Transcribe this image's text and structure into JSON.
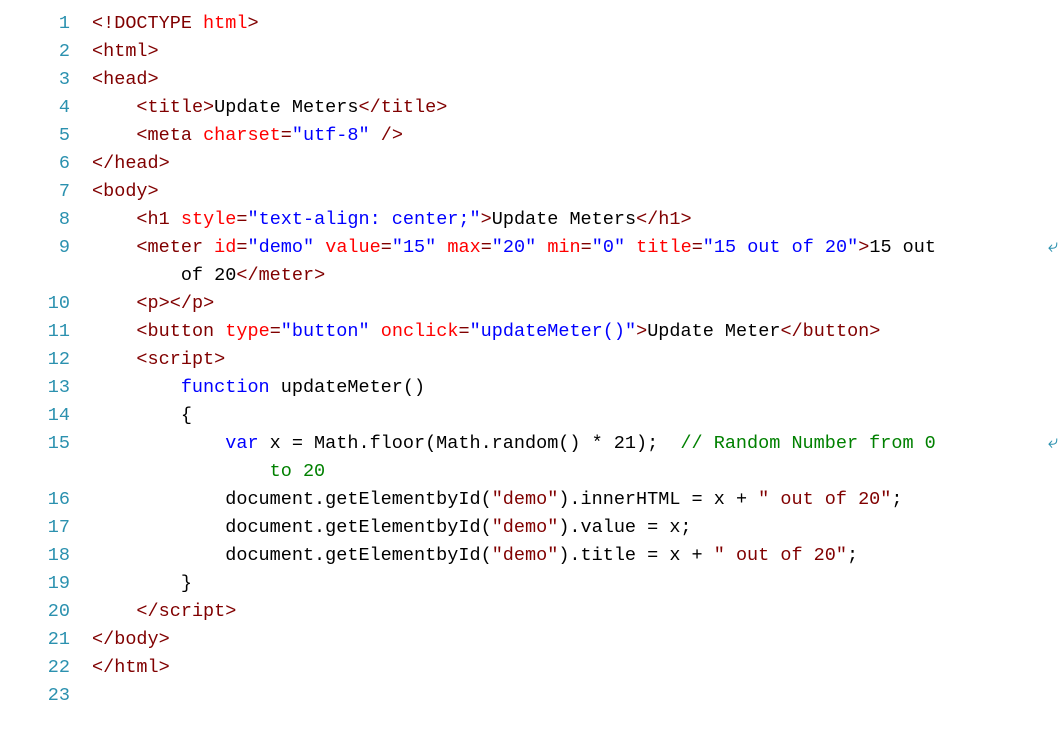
{
  "lines": [
    {
      "n": "1",
      "indent": 0,
      "wrap": false,
      "tokens": [
        {
          "c": "t-tag",
          "t": "<!"
        },
        {
          "c": "t-tagname",
          "t": "DOCTYPE"
        },
        {
          "c": "t-txt",
          "t": " "
        },
        {
          "c": "t-attr",
          "t": "html"
        },
        {
          "c": "t-tag",
          "t": ">"
        }
      ]
    },
    {
      "n": "2",
      "indent": 0,
      "wrap": false,
      "tokens": [
        {
          "c": "t-tag",
          "t": "<"
        },
        {
          "c": "t-tagname",
          "t": "html"
        },
        {
          "c": "t-tag",
          "t": ">"
        }
      ]
    },
    {
      "n": "3",
      "indent": 0,
      "wrap": false,
      "tokens": [
        {
          "c": "t-tag",
          "t": "<"
        },
        {
          "c": "t-tagname",
          "t": "head"
        },
        {
          "c": "t-tag",
          "t": ">"
        }
      ]
    },
    {
      "n": "4",
      "indent": 1,
      "wrap": false,
      "tokens": [
        {
          "c": "t-tag",
          "t": "<"
        },
        {
          "c": "t-tagname",
          "t": "title"
        },
        {
          "c": "t-tag",
          "t": ">"
        },
        {
          "c": "t-txt",
          "t": "Update Meters"
        },
        {
          "c": "t-tag",
          "t": "</"
        },
        {
          "c": "t-tagname",
          "t": "title"
        },
        {
          "c": "t-tag",
          "t": ">"
        }
      ]
    },
    {
      "n": "5",
      "indent": 1,
      "wrap": false,
      "tokens": [
        {
          "c": "t-tag",
          "t": "<"
        },
        {
          "c": "t-tagname",
          "t": "meta"
        },
        {
          "c": "t-txt",
          "t": " "
        },
        {
          "c": "t-attr",
          "t": "charset"
        },
        {
          "c": "t-tag",
          "t": "="
        },
        {
          "c": "t-str",
          "t": "\"utf-8\""
        },
        {
          "c": "t-txt",
          "t": " "
        },
        {
          "c": "t-tag",
          "t": "/>"
        }
      ]
    },
    {
      "n": "6",
      "indent": 0,
      "wrap": false,
      "tokens": [
        {
          "c": "t-tag",
          "t": "</"
        },
        {
          "c": "t-tagname",
          "t": "head"
        },
        {
          "c": "t-tag",
          "t": ">"
        }
      ]
    },
    {
      "n": "7",
      "indent": 0,
      "wrap": false,
      "tokens": [
        {
          "c": "t-tag",
          "t": "<"
        },
        {
          "c": "t-tagname",
          "t": "body"
        },
        {
          "c": "t-tag",
          "t": ">"
        }
      ]
    },
    {
      "n": "8",
      "indent": 1,
      "wrap": false,
      "tokens": [
        {
          "c": "t-tag",
          "t": "<"
        },
        {
          "c": "t-tagname",
          "t": "h1"
        },
        {
          "c": "t-txt",
          "t": " "
        },
        {
          "c": "t-attr",
          "t": "style"
        },
        {
          "c": "t-tag",
          "t": "="
        },
        {
          "c": "t-str",
          "t": "\"text-align: center;\""
        },
        {
          "c": "t-tag",
          "t": ">"
        },
        {
          "c": "t-txt",
          "t": "Update Meters"
        },
        {
          "c": "t-tag",
          "t": "</"
        },
        {
          "c": "t-tagname",
          "t": "h1"
        },
        {
          "c": "t-tag",
          "t": ">"
        }
      ]
    },
    {
      "n": "9",
      "indent": 1,
      "wrap": true,
      "tokens": [
        {
          "c": "t-tag",
          "t": "<"
        },
        {
          "c": "t-tagname",
          "t": "meter"
        },
        {
          "c": "t-txt",
          "t": " "
        },
        {
          "c": "t-attr",
          "t": "id"
        },
        {
          "c": "t-tag",
          "t": "="
        },
        {
          "c": "t-str",
          "t": "\"demo\""
        },
        {
          "c": "t-txt",
          "t": " "
        },
        {
          "c": "t-attr",
          "t": "value"
        },
        {
          "c": "t-tag",
          "t": "="
        },
        {
          "c": "t-str",
          "t": "\"15\""
        },
        {
          "c": "t-txt",
          "t": " "
        },
        {
          "c": "t-attr",
          "t": "max"
        },
        {
          "c": "t-tag",
          "t": "="
        },
        {
          "c": "t-str",
          "t": "\"20\""
        },
        {
          "c": "t-txt",
          "t": " "
        },
        {
          "c": "t-attr",
          "t": "min"
        },
        {
          "c": "t-tag",
          "t": "="
        },
        {
          "c": "t-str",
          "t": "\"0\""
        },
        {
          "c": "t-txt",
          "t": " "
        },
        {
          "c": "t-attr",
          "t": "title"
        },
        {
          "c": "t-tag",
          "t": "="
        },
        {
          "c": "t-str",
          "t": "\"15 out of 20\""
        },
        {
          "c": "t-tag",
          "t": ">"
        },
        {
          "c": "t-txt",
          "t": "15 out "
        }
      ]
    },
    {
      "n": "",
      "indent": 2,
      "wrap": false,
      "tokens": [
        {
          "c": "t-txt",
          "t": "of 20"
        },
        {
          "c": "t-tag",
          "t": "</"
        },
        {
          "c": "t-tagname",
          "t": "meter"
        },
        {
          "c": "t-tag",
          "t": ">"
        }
      ]
    },
    {
      "n": "10",
      "indent": 1,
      "wrap": false,
      "tokens": [
        {
          "c": "t-tag",
          "t": "<"
        },
        {
          "c": "t-tagname",
          "t": "p"
        },
        {
          "c": "t-tag",
          "t": ">"
        },
        {
          "c": "t-tag",
          "t": "</"
        },
        {
          "c": "t-tagname",
          "t": "p"
        },
        {
          "c": "t-tag",
          "t": ">"
        }
      ]
    },
    {
      "n": "11",
      "indent": 1,
      "wrap": false,
      "tokens": [
        {
          "c": "t-tag",
          "t": "<"
        },
        {
          "c": "t-tagname",
          "t": "button"
        },
        {
          "c": "t-txt",
          "t": " "
        },
        {
          "c": "t-attr",
          "t": "type"
        },
        {
          "c": "t-tag",
          "t": "="
        },
        {
          "c": "t-str",
          "t": "\"button\""
        },
        {
          "c": "t-txt",
          "t": " "
        },
        {
          "c": "t-attr",
          "t": "onclick"
        },
        {
          "c": "t-tag",
          "t": "="
        },
        {
          "c": "t-str",
          "t": "\"updateMeter()\""
        },
        {
          "c": "t-tag",
          "t": ">"
        },
        {
          "c": "t-txt",
          "t": "Update Meter"
        },
        {
          "c": "t-tag",
          "t": "</"
        },
        {
          "c": "t-tagname",
          "t": "button"
        },
        {
          "c": "t-tag",
          "t": ">"
        }
      ]
    },
    {
      "n": "12",
      "indent": 1,
      "wrap": false,
      "tokens": [
        {
          "c": "t-tag",
          "t": "<"
        },
        {
          "c": "t-tagname",
          "t": "script"
        },
        {
          "c": "t-tag",
          "t": ">"
        }
      ]
    },
    {
      "n": "13",
      "indent": 2,
      "wrap": false,
      "tokens": [
        {
          "c": "t-kw",
          "t": "function"
        },
        {
          "c": "t-txt",
          "t": " updateMeter()"
        }
      ]
    },
    {
      "n": "14",
      "indent": 2,
      "wrap": false,
      "tokens": [
        {
          "c": "t-txt",
          "t": "{"
        }
      ]
    },
    {
      "n": "15",
      "indent": 3,
      "wrap": true,
      "tokens": [
        {
          "c": "t-kw",
          "t": "var"
        },
        {
          "c": "t-txt",
          "t": " x = Math.floor(Math.random() * 21);  "
        },
        {
          "c": "t-cmt",
          "t": "// Random Number from 0 "
        }
      ]
    },
    {
      "n": "",
      "indent": 4,
      "wrap": false,
      "tokens": [
        {
          "c": "t-cmt",
          "t": "to 20"
        }
      ]
    },
    {
      "n": "16",
      "indent": 3,
      "wrap": false,
      "tokens": [
        {
          "c": "t-txt",
          "t": "document.getElementbyId("
        },
        {
          "c": "t-tag",
          "t": "\"demo\""
        },
        {
          "c": "t-txt",
          "t": ").innerHTML = x + "
        },
        {
          "c": "t-tag",
          "t": "\" out of 20\""
        },
        {
          "c": "t-txt",
          "t": ";"
        }
      ]
    },
    {
      "n": "17",
      "indent": 3,
      "wrap": false,
      "tokens": [
        {
          "c": "t-txt",
          "t": "document.getElementbyId("
        },
        {
          "c": "t-tag",
          "t": "\"demo\""
        },
        {
          "c": "t-txt",
          "t": ").value = x;"
        }
      ]
    },
    {
      "n": "18",
      "indent": 3,
      "wrap": false,
      "tokens": [
        {
          "c": "t-txt",
          "t": "document.getElementbyId("
        },
        {
          "c": "t-tag",
          "t": "\"demo\""
        },
        {
          "c": "t-txt",
          "t": ").title = x + "
        },
        {
          "c": "t-tag",
          "t": "\" out of 20\""
        },
        {
          "c": "t-txt",
          "t": ";"
        }
      ]
    },
    {
      "n": "19",
      "indent": 2,
      "wrap": false,
      "tokens": [
        {
          "c": "t-txt",
          "t": "}"
        }
      ]
    },
    {
      "n": "20",
      "indent": 1,
      "wrap": false,
      "tokens": [
        {
          "c": "t-tag",
          "t": "</"
        },
        {
          "c": "t-tagname",
          "t": "script"
        },
        {
          "c": "t-tag",
          "t": ">"
        }
      ]
    },
    {
      "n": "21",
      "indent": 0,
      "wrap": false,
      "tokens": [
        {
          "c": "t-tag",
          "t": "</"
        },
        {
          "c": "t-tagname",
          "t": "body"
        },
        {
          "c": "t-tag",
          "t": ">"
        }
      ]
    },
    {
      "n": "22",
      "indent": 0,
      "wrap": false,
      "tokens": [
        {
          "c": "t-tag",
          "t": "</"
        },
        {
          "c": "t-tagname",
          "t": "html"
        },
        {
          "c": "t-tag",
          "t": ">"
        }
      ]
    },
    {
      "n": "23",
      "indent": 0,
      "wrap": false,
      "tokens": []
    }
  ],
  "indentUnit": "    ",
  "wrapGlyph": "↩"
}
